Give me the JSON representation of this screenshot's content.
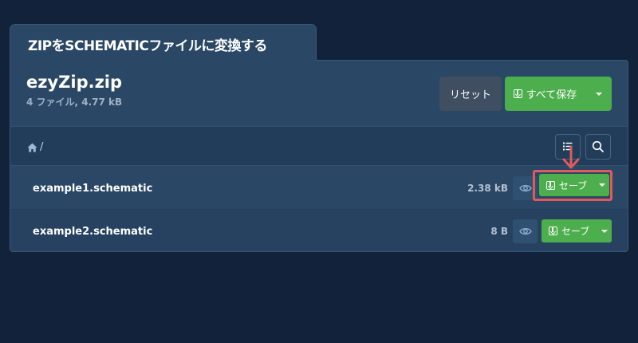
{
  "page": {
    "title": "ZIPをSCHEMATICファイルに変換する"
  },
  "archive": {
    "name": "ezyZip.zip",
    "meta": "4 ファイル, 4.77 kB"
  },
  "header_buttons": {
    "reset_label": "リセット",
    "save_all_label": "すべて保存"
  },
  "breadcrumb": {
    "path": "/"
  },
  "files": [
    {
      "name": "example1.schematic",
      "size": "2.38 kB",
      "save_label": "セーブ"
    },
    {
      "name": "example2.schematic",
      "size": "8 B",
      "save_label": "セーブ"
    }
  ],
  "colors": {
    "background": "#12223a",
    "panel": "#2a4766",
    "accent_green": "#4cae4c",
    "highlight_red": "#e25a5a"
  },
  "icons": {
    "home": "home-icon",
    "list": "list-icon",
    "search": "search-icon",
    "eye": "eye-icon",
    "download": "download-icon",
    "caret": "caret-down-icon",
    "annotation_arrow": "arrow-down-icon"
  }
}
